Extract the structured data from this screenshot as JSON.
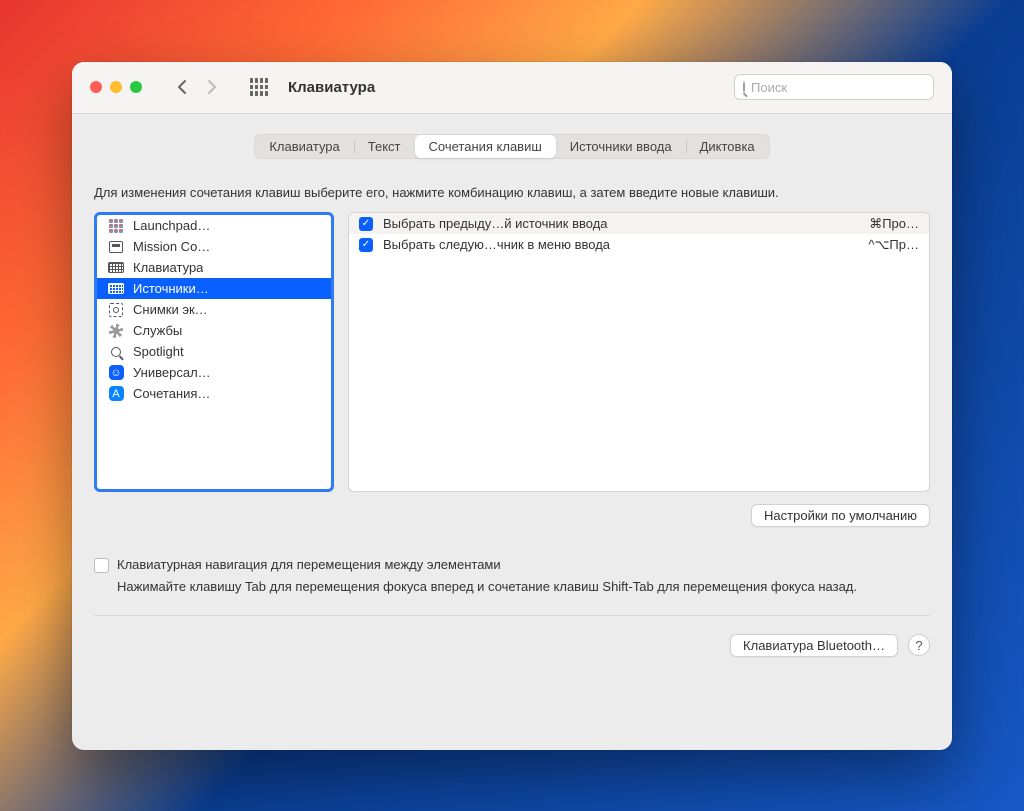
{
  "window": {
    "title": "Клавиатура"
  },
  "search": {
    "placeholder": "Поиск"
  },
  "tabs": [
    {
      "label": "Клавиатура",
      "active": false
    },
    {
      "label": "Текст",
      "active": false
    },
    {
      "label": "Сочетания клавиш",
      "active": true
    },
    {
      "label": "Источники ввода",
      "active": false
    },
    {
      "label": "Диктовка",
      "active": false
    }
  ],
  "instruction": "Для изменения сочетания клавиш выберите его, нажмите комбинацию клавиш, а затем введите новые клавиши.",
  "categories": [
    {
      "icon": "launchpad",
      "label": "Launchpad…",
      "selected": false
    },
    {
      "icon": "mission",
      "label": "Mission Co…",
      "selected": false
    },
    {
      "icon": "keyboard",
      "label": "Клавиатура",
      "selected": false
    },
    {
      "icon": "keyboard",
      "label": "Источники…",
      "selected": true
    },
    {
      "icon": "screenshot",
      "label": "Снимки эк…",
      "selected": false
    },
    {
      "icon": "services",
      "label": "Службы",
      "selected": false
    },
    {
      "icon": "spotlight",
      "label": "Spotlight",
      "selected": false
    },
    {
      "icon": "universal",
      "label": "Универсал…",
      "selected": false
    },
    {
      "icon": "app",
      "label": "Сочетания…",
      "selected": false
    }
  ],
  "shortcuts": [
    {
      "checked": true,
      "label": "Выбрать предыду…й источник ввода",
      "key": "⌘Про…"
    },
    {
      "checked": true,
      "label": "Выбрать следую…чник в меню ввода",
      "key": "^⌥Пр…"
    }
  ],
  "defaults_button": "Настройки по умолчанию",
  "keyboard_nav": {
    "checkbox_label": "Клавиатурная навигация для перемещения между элементами",
    "description": "Нажимайте клавишу Tab для перемещения фокуса вперед и сочетание клавиш Shift-Tab для перемещения фокуса назад."
  },
  "footer": {
    "bluetooth_button": "Клавиатура Bluetooth…",
    "help": "?"
  }
}
